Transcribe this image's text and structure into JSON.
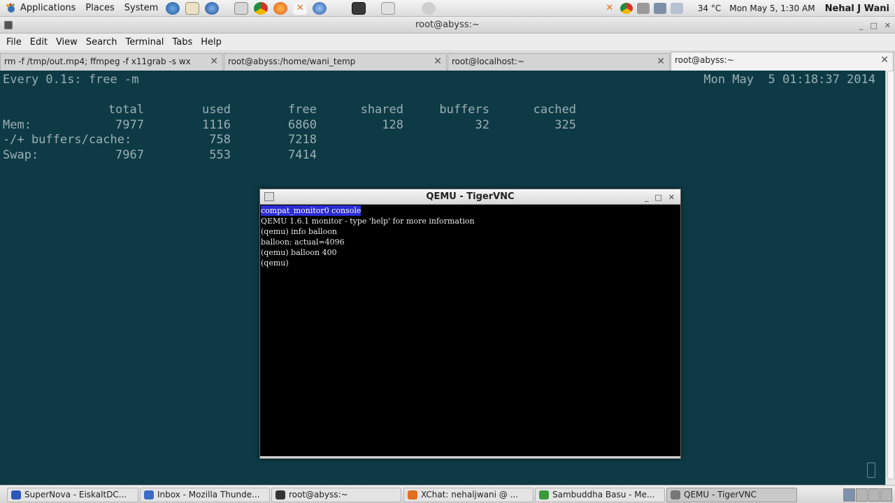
{
  "top_panel": {
    "applications": "Applications",
    "places": "Places",
    "system": "System",
    "temperature": "34 °C",
    "clock": "Mon May  5,  1:30 AM",
    "user": "Nehal J Wani"
  },
  "window": {
    "title": "root@abyss:~",
    "menu": [
      "File",
      "Edit",
      "View",
      "Search",
      "Terminal",
      "Tabs",
      "Help"
    ]
  },
  "tabs": [
    {
      "label": "rm -f /tmp/out.mp4; ffmpeg -f x11grab -s wx..."
    },
    {
      "label": "root@abyss:/home/wani_temp"
    },
    {
      "label": "root@localhost:~"
    },
    {
      "label": "root@abyss:~"
    }
  ],
  "terminal": {
    "watch_cmd": "Every 0.1s: free -m",
    "timestamp": "Mon May  5 01:18:37 2014",
    "headers": [
      "total",
      "used",
      "free",
      "shared",
      "buffers",
      "cached"
    ],
    "rows": [
      {
        "label": "Mem:",
        "values": [
          "7977",
          "1116",
          "6860",
          "128",
          "32",
          "325"
        ]
      },
      {
        "label": "-/+ buffers/cache:",
        "values": [
          "",
          "758",
          "7218",
          "",
          "",
          ""
        ]
      },
      {
        "label": "Swap:",
        "values": [
          "7967",
          "553",
          "7414",
          "",
          "",
          ""
        ]
      }
    ]
  },
  "qemu": {
    "title": "QEMU - TigerVNC",
    "lines": [
      "compat_monitor0 console",
      "QEMU 1.6.1 monitor - type 'help' for more information",
      "(qemu) info balloon",
      "balloon: actual=4096",
      "(qemu) balloon 400",
      "(qemu)"
    ]
  },
  "taskbar": {
    "items": [
      {
        "label": "SuperNova - EiskaltDC...",
        "icon": "eiskaltdc-icon",
        "color": "#2d57b8"
      },
      {
        "label": "Inbox - Mozilla Thunde...",
        "icon": "thunderbird-icon",
        "color": "#3a6bc7"
      },
      {
        "label": "root@abyss:~",
        "icon": "terminal-icon",
        "color": "#333333"
      },
      {
        "label": "XChat: nehaljwani @ ...",
        "icon": "xchat-icon",
        "color": "#e07020"
      },
      {
        "label": "Sambuddha Basu - Me...",
        "icon": "chrome-icon",
        "color": "#3a9a3a"
      },
      {
        "label": "QEMU - TigerVNC",
        "icon": "tigervnc-icon",
        "color": "#777777"
      }
    ]
  }
}
